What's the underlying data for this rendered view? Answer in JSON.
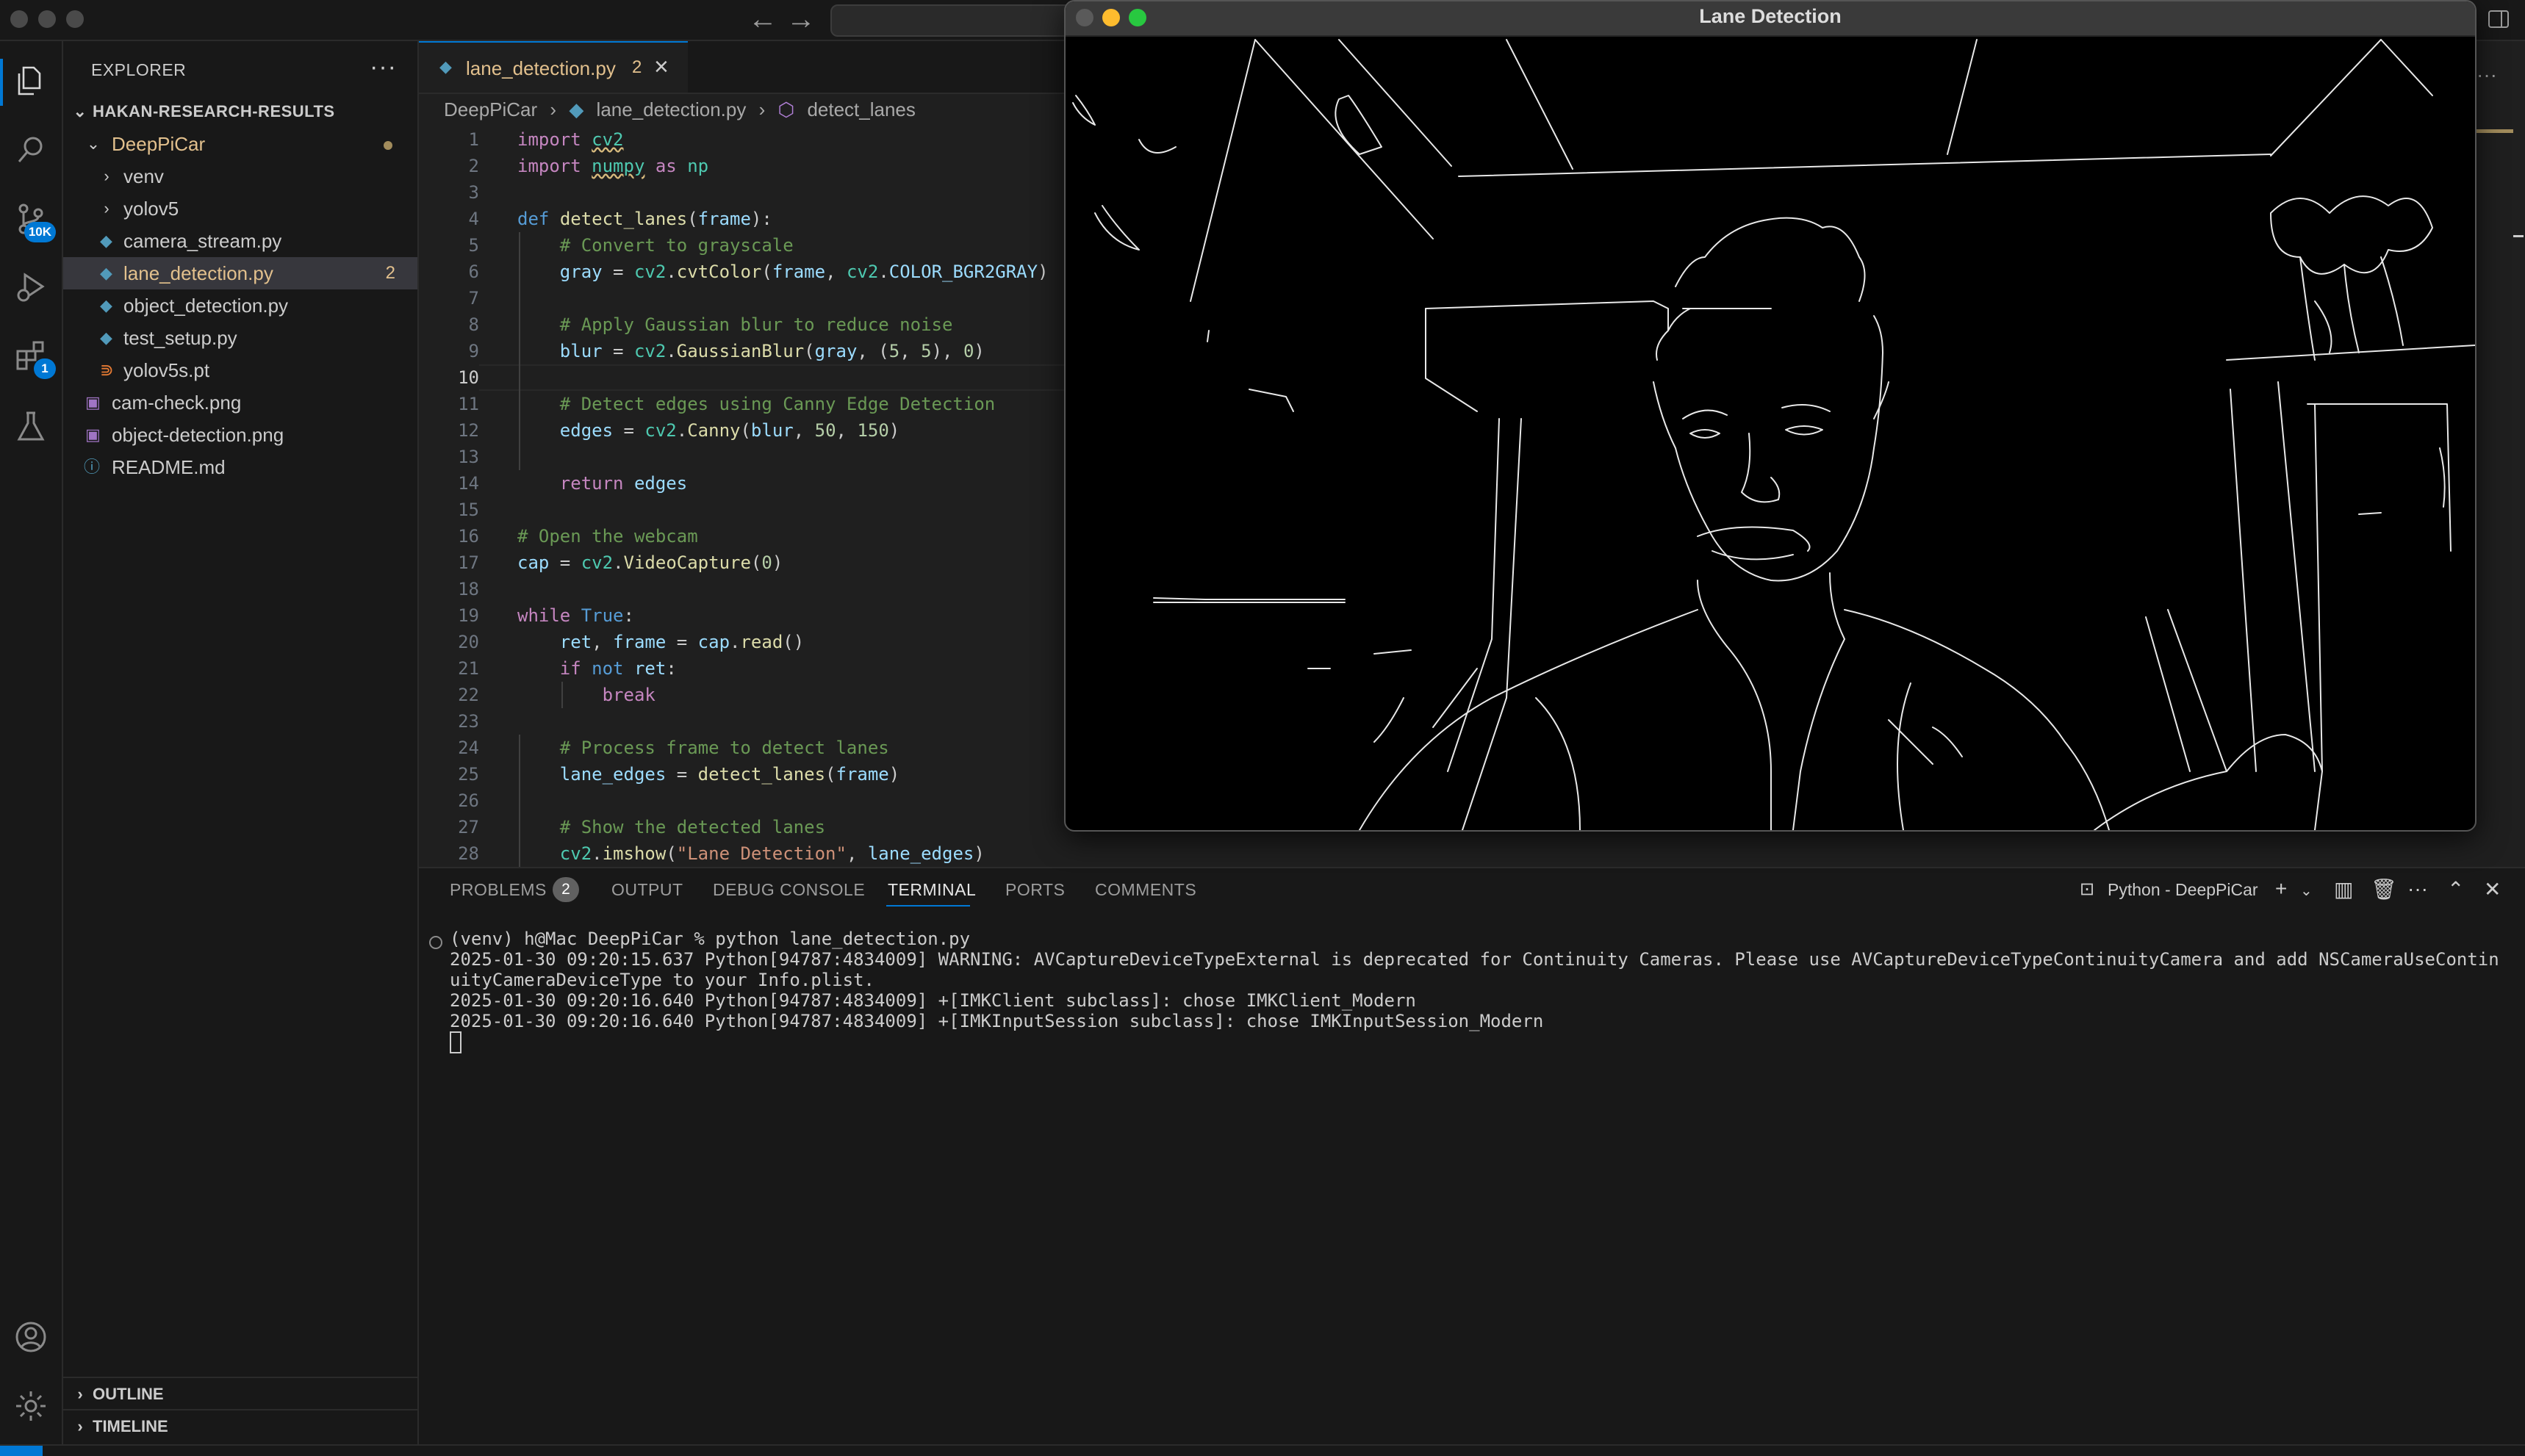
{
  "window": {
    "cv_title": "Lane Detection"
  },
  "activity_bar": {
    "source_control_badge": "10K",
    "extensions_badge": "1"
  },
  "explorer": {
    "title": "EXPLORER",
    "root": "HAKAN-RESEARCH-RESULTS",
    "items": [
      {
        "label": "DeepPiCar",
        "kind": "folder-open"
      },
      {
        "label": "venv",
        "kind": "folder"
      },
      {
        "label": "yolov5",
        "kind": "folder"
      },
      {
        "label": "camera_stream.py",
        "kind": "python"
      },
      {
        "label": "lane_detection.py",
        "kind": "python",
        "badge": "2"
      },
      {
        "label": "object_detection.py",
        "kind": "python"
      },
      {
        "label": "test_setup.py",
        "kind": "python"
      },
      {
        "label": "yolov5s.pt",
        "kind": "rss"
      },
      {
        "label": "cam-check.png",
        "kind": "image"
      },
      {
        "label": "object-detection.png",
        "kind": "image"
      },
      {
        "label": "README.md",
        "kind": "info"
      }
    ],
    "outline": "OUTLINE",
    "timeline": "TIMELINE"
  },
  "editor": {
    "tab": {
      "label": "lane_detection.py",
      "badge": "2"
    },
    "breadcrumbs": [
      "DeepPiCar",
      "lane_detection.py",
      "detect_lanes"
    ],
    "line_numbers": [
      "1",
      "2",
      "3",
      "4",
      "5",
      "6",
      "7",
      "8",
      "9",
      "10",
      "11",
      "12",
      "13",
      "14",
      "15",
      "16",
      "17",
      "18",
      "19",
      "20",
      "21",
      "22",
      "23",
      "24",
      "25",
      "26",
      "27",
      "28"
    ]
  },
  "panel": {
    "tabs": [
      "PROBLEMS",
      "OUTPUT",
      "DEBUG CONSOLE",
      "TERMINAL",
      "PORTS",
      "COMMENTS"
    ],
    "problems_count": "2",
    "terminal_profile": "Python - DeepPiCar",
    "terminal_lines": [
      "(venv) h@Mac DeepPiCar % python lane_detection.py",
      "2025-01-30 09:20:15.637 Python[94787:4834009] WARNING: AVCaptureDeviceTypeExternal is deprecated for Continuity Cameras. Please use AVCaptureDeviceTypeContinuityCamera and add NSCameraUseContinuityCameraDeviceType to your Info.plist.",
      "2025-01-30 09:20:16.640 Python[94787:4834009] +[IMKClient subclass]: chose IMKClient_Modern",
      "2025-01-30 09:20:16.640 Python[94787:4834009] +[IMKInputSession subclass]: chose IMKInputSession_Modern"
    ]
  }
}
